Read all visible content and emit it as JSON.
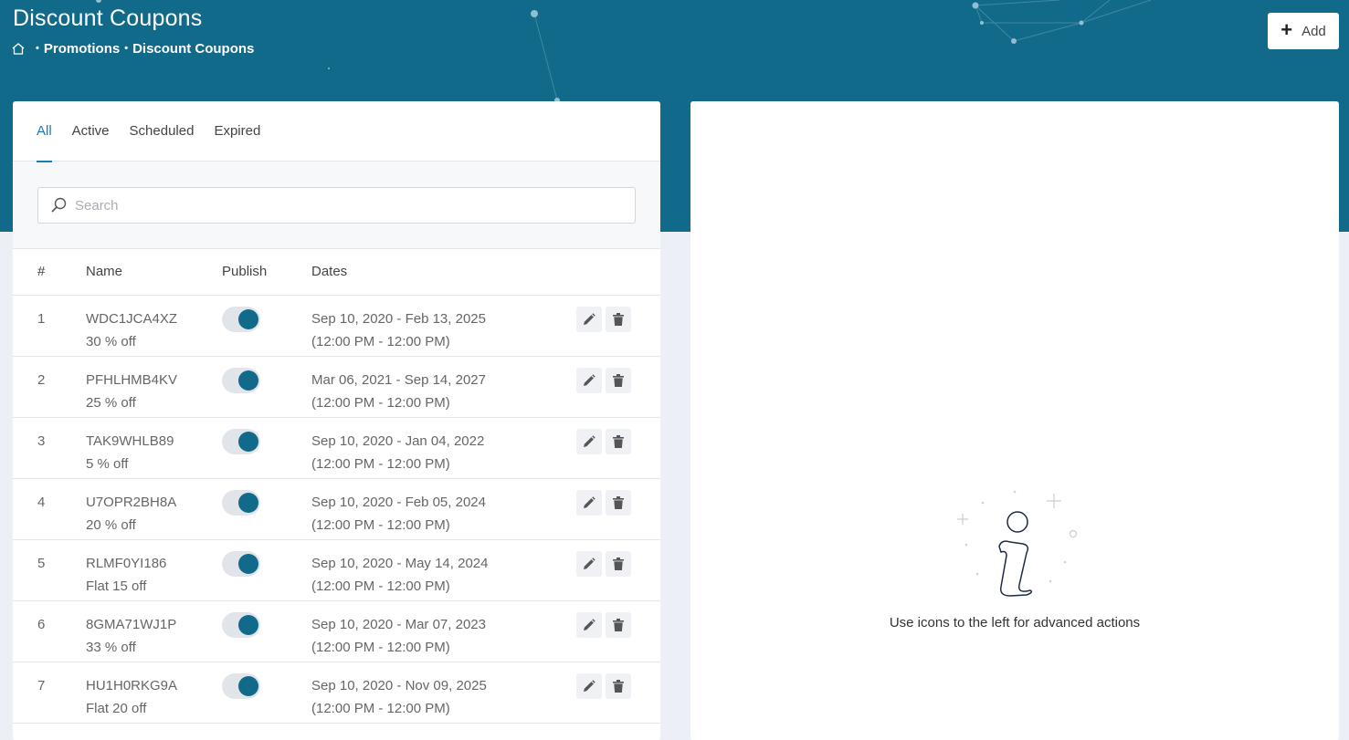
{
  "header": {
    "title": "Discount Coupons",
    "breadcrumb": [
      "Promotions",
      "Discount Coupons"
    ],
    "add_label": "Add"
  },
  "tabs": [
    {
      "label": "All",
      "active": true
    },
    {
      "label": "Active",
      "active": false
    },
    {
      "label": "Scheduled",
      "active": false
    },
    {
      "label": "Expired",
      "active": false
    }
  ],
  "search": {
    "placeholder": "Search",
    "value": ""
  },
  "table": {
    "headers": {
      "num": "#",
      "name": "Name",
      "publish": "Publish",
      "dates": "Dates"
    },
    "rows": [
      {
        "num": "1",
        "code": "WDC1JCA4XZ",
        "discount": "30 % off",
        "published": true,
        "dates": "Sep 10, 2020 - Feb 13, 2025",
        "times": "(12:00 PM - 12:00 PM)"
      },
      {
        "num": "2",
        "code": "PFHLHMB4KV",
        "discount": "25 % off",
        "published": true,
        "dates": "Mar 06, 2021 - Sep 14, 2027",
        "times": "(12:00 PM - 12:00 PM)"
      },
      {
        "num": "3",
        "code": "TAK9WHLB89",
        "discount": "5 % off",
        "published": true,
        "dates": "Sep 10, 2020 - Jan 04, 2022",
        "times": "(12:00 PM - 12:00 PM)"
      },
      {
        "num": "4",
        "code": "U7OPR2BH8A",
        "discount": "20 % off",
        "published": true,
        "dates": "Sep 10, 2020 - Feb 05, 2024",
        "times": "(12:00 PM - 12:00 PM)"
      },
      {
        "num": "5",
        "code": "RLMF0YI186",
        "discount": "Flat 15 off",
        "published": true,
        "dates": "Sep 10, 2020 - May 14, 2024",
        "times": "(12:00 PM - 12:00 PM)"
      },
      {
        "num": "6",
        "code": "8GMA71WJ1P",
        "discount": "33 % off",
        "published": true,
        "dates": "Sep 10, 2020 - Mar 07, 2023",
        "times": "(12:00 PM - 12:00 PM)"
      },
      {
        "num": "7",
        "code": "HU1H0RKG9A",
        "discount": "Flat 20 off",
        "published": true,
        "dates": "Sep 10, 2020 - Nov 09, 2025",
        "times": "(12:00 PM - 12:00 PM)"
      }
    ]
  },
  "empty_state": {
    "message": "Use icons to the left for advanced actions",
    "icon": "info-icon"
  },
  "colors": {
    "header_bg": "#126a8a",
    "accent": "#1b7bb8",
    "toggle_on": "#126a8a"
  }
}
